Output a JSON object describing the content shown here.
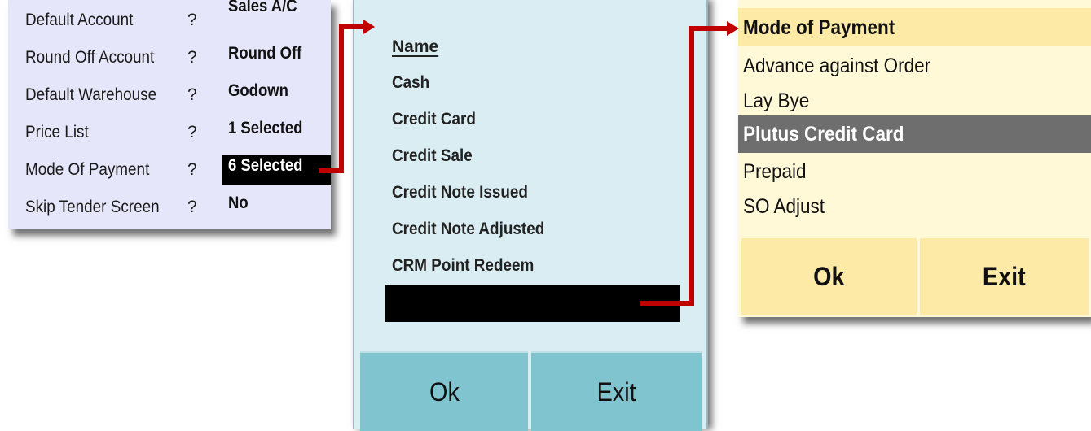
{
  "settings": {
    "rows": [
      {
        "label": "Default Account",
        "q": "?",
        "value": "Sales A/C",
        "selected": false
      },
      {
        "label": "Round Off Account",
        "q": "?",
        "value": "Round Off",
        "selected": false
      },
      {
        "label": "Default Warehouse",
        "q": "?",
        "value": "Godown",
        "selected": false
      },
      {
        "label": "Price List",
        "q": "?",
        "value": "1 Selected",
        "selected": false
      },
      {
        "label": "Mode Of Payment",
        "q": "?",
        "value": "6 Selected",
        "selected": true
      },
      {
        "label": "Skip Tender Screen",
        "q": "?",
        "value": "No",
        "selected": false
      }
    ]
  },
  "name_list": {
    "header": "Name",
    "items": [
      "Cash",
      "Credit Card",
      "Credit Sale",
      "Credit Note Issued",
      "Credit Note Adjusted",
      "CRM Point Redeem"
    ],
    "ok_label": "Ok",
    "exit_label": "Exit"
  },
  "mode_of_payment": {
    "header": "Mode of Payment",
    "items": [
      {
        "label": "Advance against Order",
        "highlighted": false
      },
      {
        "label": "Lay Bye",
        "highlighted": false
      },
      {
        "label": "Plutus Credit Card",
        "highlighted": true
      },
      {
        "label": "Prepaid",
        "highlighted": false
      },
      {
        "label": "SO Adjust",
        "highlighted": false
      }
    ],
    "ok_label": "Ok",
    "exit_label": "Exit"
  },
  "colors": {
    "settings_bg": "#e6e6fa",
    "name_panel_bg": "#daedf2",
    "name_button_bg": "#80c4d0",
    "mop_panel_bg": "#fff9d8",
    "mop_header_bg": "#fdeaa7",
    "highlight_bg": "#6e6e6e",
    "arrow": "#c00000"
  }
}
